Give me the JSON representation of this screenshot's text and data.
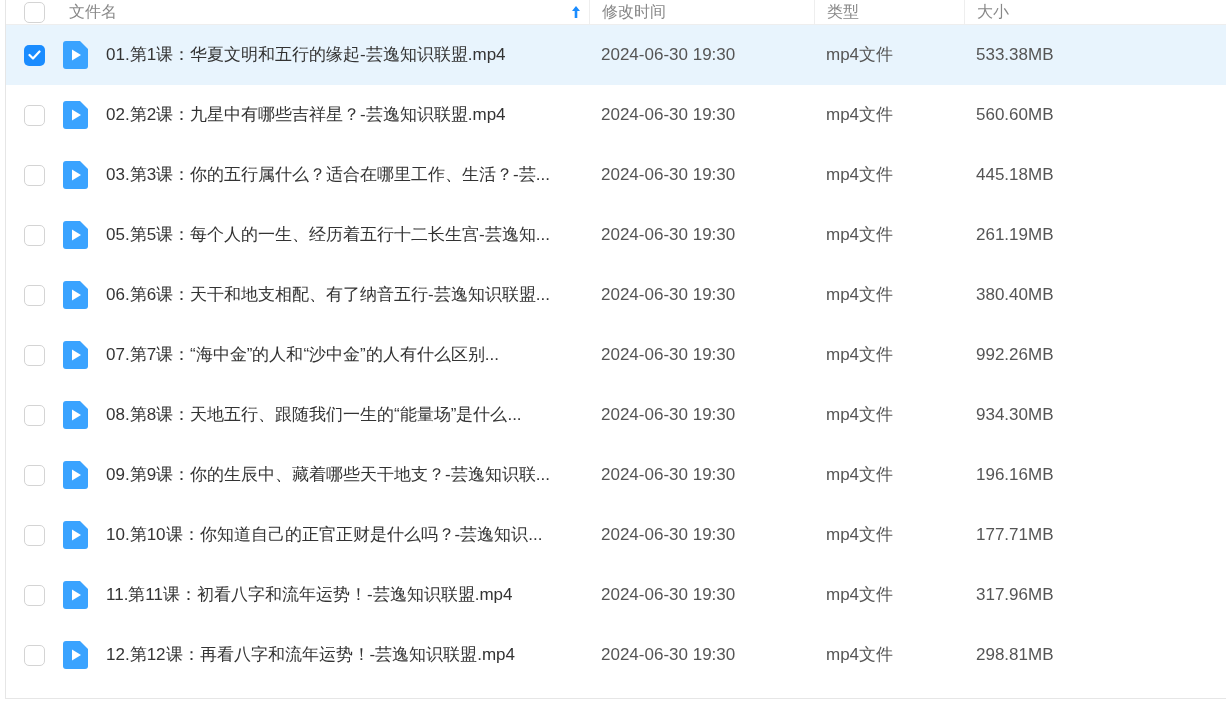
{
  "header": {
    "checked": false,
    "columns": [
      {
        "label": "文件名",
        "sorted": true
      },
      {
        "label": "修改时间",
        "sorted": false
      },
      {
        "label": "类型",
        "sorted": false
      },
      {
        "label": "大小",
        "sorted": false
      }
    ]
  },
  "rows": [
    {
      "name": "01.第1课：华夏文明和五行的缘起-芸逸知识联盟.mp4",
      "modified": "2024-06-30 19:30",
      "type": "mp4文件",
      "size": "533.38MB",
      "selected": true
    },
    {
      "name": "02.第2课：九星中有哪些吉祥星？-芸逸知识联盟.mp4",
      "modified": "2024-06-30 19:30",
      "type": "mp4文件",
      "size": "560.60MB",
      "selected": false
    },
    {
      "name": "03.第3课：你的五行属什么？适合在哪里工作、生活？-芸...",
      "modified": "2024-06-30 19:30",
      "type": "mp4文件",
      "size": "445.18MB",
      "selected": false
    },
    {
      "name": "05.第5课：每个人的一生、经历着五行十二长生宫-芸逸知...",
      "modified": "2024-06-30 19:30",
      "type": "mp4文件",
      "size": "261.19MB",
      "selected": false
    },
    {
      "name": "06.第6课：天干和地支相配、有了纳音五行-芸逸知识联盟...",
      "modified": "2024-06-30 19:30",
      "type": "mp4文件",
      "size": "380.40MB",
      "selected": false
    },
    {
      "name": "07.第7课：“海中金”的人和“沙中金”的人有什么区别...",
      "modified": "2024-06-30 19:30",
      "type": "mp4文件",
      "size": "992.26MB",
      "selected": false
    },
    {
      "name": "08.第8课：天地五行、跟随我们一生的“能量场”是什么...",
      "modified": "2024-06-30 19:30",
      "type": "mp4文件",
      "size": "934.30MB",
      "selected": false
    },
    {
      "name": "09.第9课：你的生辰中、藏着哪些天干地支？-芸逸知识联...",
      "modified": "2024-06-30 19:30",
      "type": "mp4文件",
      "size": "196.16MB",
      "selected": false
    },
    {
      "name": "10.第10课：你知道自己的正官正财是什么吗？-芸逸知识...",
      "modified": "2024-06-30 19:30",
      "type": "mp4文件",
      "size": "177.71MB",
      "selected": false
    },
    {
      "name": "11.第11课：初看八字和流年运势！-芸逸知识联盟.mp4",
      "modified": "2024-06-30 19:30",
      "type": "mp4文件",
      "size": "317.96MB",
      "selected": false
    },
    {
      "name": "12.第12课：再看八字和流年运势！-芸逸知识联盟.mp4",
      "modified": "2024-06-30 19:30",
      "type": "mp4文件",
      "size": "298.81MB",
      "selected": false
    }
  ]
}
